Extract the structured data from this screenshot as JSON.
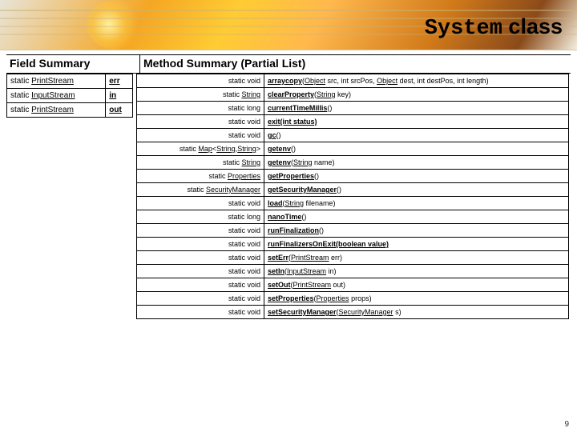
{
  "title": {
    "code": "System",
    "word": "class"
  },
  "headers": {
    "fields": "Field Summary",
    "methods": "Method Summary (Partial List)"
  },
  "fields": [
    {
      "mod": "static ",
      "type": "PrintStream",
      "name": "err"
    },
    {
      "mod": "static ",
      "type": "InputStream",
      "name": "in"
    },
    {
      "mod": "static ",
      "type": "PrintStream",
      "name": "out"
    }
  ],
  "methods": [
    {
      "ret_mod": "static  void",
      "name": "arraycopy",
      "params": [
        {
          "t": "Object",
          "n": " src",
          "u": true
        },
        {
          "t": ", int  srcPos",
          "n": "",
          "u": false
        },
        {
          "t": ", ",
          "n": ""
        },
        {
          "t": "Object",
          "n": " dest",
          "u": true
        },
        {
          "t": ", int  destPos, int  length)",
          "n": ""
        }
      ],
      "sig_html": "(<span class='ul'>Object</span> src, int srcPos, <span class='ul'>Object</span> dest, int destPos, int length)"
    },
    {
      "ret_mod": "static ",
      "ret_type": "String",
      "ret_u": true,
      "name": "clearProperty",
      "sig_html": "(<span class='ul'>String</span> key)"
    },
    {
      "ret_mod": "static  long",
      "name": "currentTimeMillis",
      "sig_html": "()"
    },
    {
      "ret_mod": "static  void",
      "name": "exit",
      "sig_html": "(int status)",
      "bold_sig": true
    },
    {
      "ret_mod": "static  void",
      "name": "gc",
      "sig_html": "()"
    },
    {
      "ret_mod": "static ",
      "ret_type": "Map",
      "ret_u": true,
      "ret_extra": "<<span class='ul'>String</span>,<span class='ul'>String</span>>",
      "name": "getenv",
      "sig_html": "()"
    },
    {
      "ret_mod": "static ",
      "ret_type": "String",
      "ret_u": true,
      "name": "getenv",
      "sig_html": "(<span class='ul'>String</span> name)"
    },
    {
      "ret_mod": "static ",
      "ret_type": "Properties",
      "ret_u": true,
      "name": "getProperties",
      "sig_html": "()"
    },
    {
      "ret_mod": "static ",
      "ret_type": "SecurityManager",
      "ret_u": true,
      "name": "getSecurityManager",
      "sig_html": "()"
    },
    {
      "ret_mod": "static  void",
      "name": "load",
      "sig_html": "(<span class='ul'>String</span> filename)"
    },
    {
      "ret_mod": "static  long",
      "name": "nanoTime",
      "sig_html": "()"
    },
    {
      "ret_mod": "static  void",
      "name": "runFinalization",
      "sig_html": "()"
    },
    {
      "ret_mod": "static  void",
      "name": "runFinalizersOnExit",
      "sig_html": "(boolean value)",
      "bold_sig": true
    },
    {
      "ret_mod": "static  void",
      "name": "setErr",
      "sig_html": "(<span class='ul'>PrintStream</span> err)"
    },
    {
      "ret_mod": "static  void",
      "name": "setIn",
      "sig_html": "(<span class='ul'>InputStream</span> in)"
    },
    {
      "ret_mod": "static  void",
      "name": "setOut",
      "sig_html": "(<span class='ul'>PrintStream</span> out)"
    },
    {
      "ret_mod": "static  void",
      "name": "setProperties",
      "sig_html": "(<span class='ul'>Properties</span> props)"
    },
    {
      "ret_mod": "static  void",
      "name": "setSecurityManager",
      "sig_html": "(<span class='ul'>SecurityManager</span> s)"
    }
  ],
  "page_number": "9"
}
